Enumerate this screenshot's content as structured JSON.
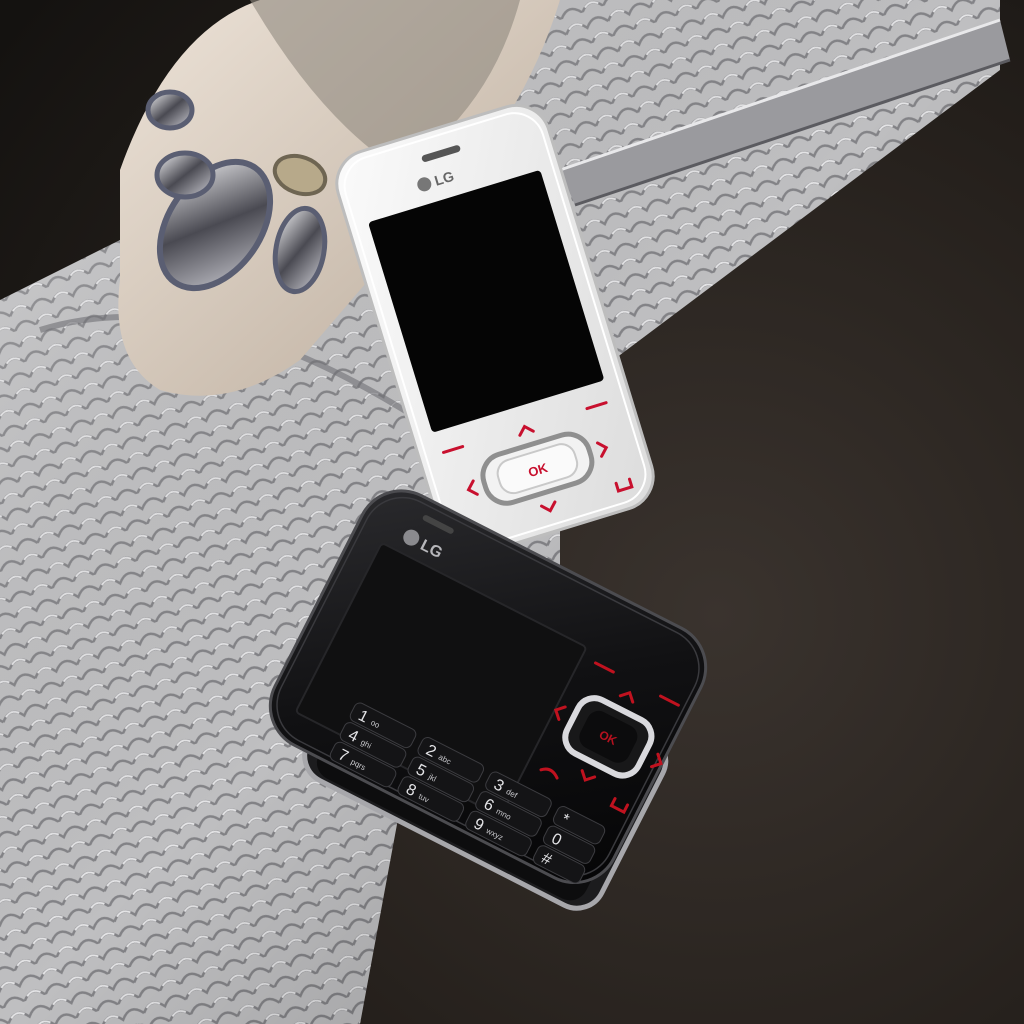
{
  "image": {
    "white_phone": {
      "brand": "LG",
      "ok_label": "OK"
    },
    "black_phone": {
      "brand": "LG",
      "ok_label": "OK",
      "keys": [
        {
          "digit": "1",
          "letters": "oo"
        },
        {
          "digit": "2",
          "letters": "abc"
        },
        {
          "digit": "3",
          "letters": "def"
        },
        {
          "digit": "4",
          "letters": "ghi"
        },
        {
          "digit": "5",
          "letters": "jkl"
        },
        {
          "digit": "6",
          "letters": "mno"
        },
        {
          "digit": "7",
          "letters": "pqrs"
        },
        {
          "digit": "8",
          "letters": "tuv"
        },
        {
          "digit": "9",
          "letters": "wxyz"
        },
        {
          "digit": "*",
          "letters": ""
        },
        {
          "digit": "0",
          "letters": ""
        },
        {
          "digit": "#",
          "letters": ""
        }
      ]
    }
  }
}
